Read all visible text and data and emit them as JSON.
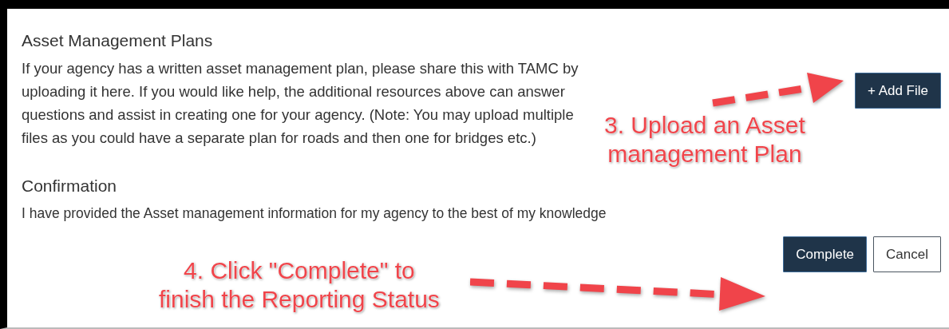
{
  "sections": [
    {
      "title": "Asset Management Plans",
      "text": "If your agency has a written asset management plan, please share this with TAMC by uploading it here. If you would like help, the additional resources above can answer questions and assist in creating one for your agency. (Note: You may upload multiple files as you could have a separate plan for roads and then one for bridges etc.)",
      "action": "+ Add File"
    },
    {
      "title": "Confirmation",
      "text": "I have provided the Asset management information for my agency to the best of my knowledge"
    }
  ],
  "buttons": [
    {
      "label": "Complete",
      "kind": "primary"
    },
    {
      "label": "Cancel",
      "kind": "secondary"
    }
  ],
  "annotations": [
    {
      "lines": [
        "3. Upload an Asset",
        "management Plan"
      ]
    },
    {
      "lines": [
        "4. Click \"Complete\" to",
        "finish the Reporting Status"
      ]
    }
  ]
}
